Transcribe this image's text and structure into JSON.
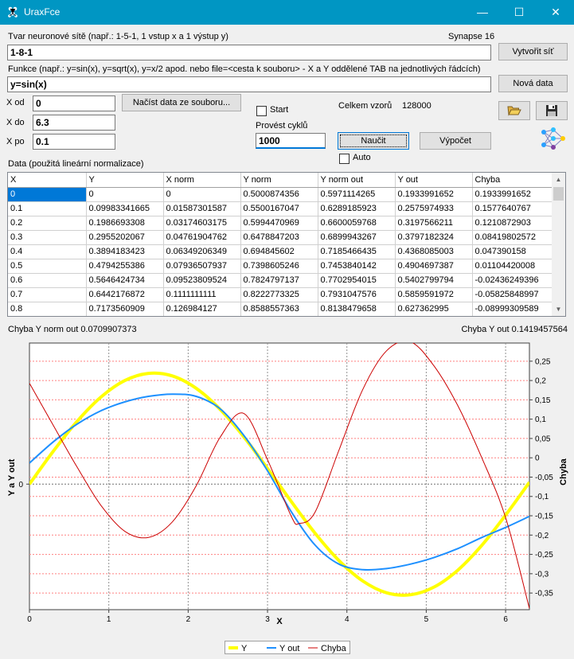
{
  "window": {
    "title": "UraxFce"
  },
  "network": {
    "label": "Tvar neuronové sítě (např.: 1-5-1, 1 vstup x a 1 výstup y)",
    "value": "1-8-1",
    "synapse": "Synapse 16",
    "create_button": "Vytvořit síť"
  },
  "function": {
    "label": "Funkce (např.: y=sin(x), y=sqrt(x), y=x/2 apod. nebo file=<cesta k souboru> - X a Y oddělené TAB na jednotlivých řádcích)",
    "value": "y=sin(x)",
    "new_data_button": "Nová data"
  },
  "range": {
    "x_from_label": "X od",
    "x_from": "0",
    "x_to_label": "X do",
    "x_to": "6.3",
    "x_step_label": "X po",
    "x_step": "0.1"
  },
  "controls": {
    "load_button": "Načíst data ze souboru...",
    "start_label": "Start",
    "cycles_label": "Provést cyklů",
    "cycles_value": "1000",
    "total_label": "Celkem vzorů",
    "total_value": "128000",
    "learn_button": "Naučit",
    "compute_button": "Výpočet",
    "auto_label": "Auto"
  },
  "data_label": "Data (použitá lineární normalizace)",
  "table": {
    "columns": [
      "X",
      "Y",
      "X norm",
      "Y norm",
      "Y norm out",
      "Y out",
      "Chyba"
    ],
    "rows": [
      [
        "0",
        "0",
        "0",
        "0.5000874356",
        "0.5971114265",
        "0.1933991652",
        "0.1933991652"
      ],
      [
        "0.1",
        "0.09983341665",
        "0.01587301587",
        "0.5500167047",
        "0.6289185923",
        "0.2575974933",
        "0.1577640767"
      ],
      [
        "0.2",
        "0.1986693308",
        "0.03174603175",
        "0.5994470969",
        "0.6600059768",
        "0.3197566211",
        "0.1210872903"
      ],
      [
        "0.3",
        "0.2955202067",
        "0.04761904762",
        "0.6478847203",
        "0.6899943267",
        "0.3797182324",
        "0.08419802572"
      ],
      [
        "0.4",
        "0.3894183423",
        "0.06349206349",
        "0.694845602",
        "0.7185466435",
        "0.4368085003",
        "0.047390158"
      ],
      [
        "0.5",
        "0.4794255386",
        "0.07936507937",
        "0.7398605246",
        "0.7453840142",
        "0.4904697387",
        "0.01104420008"
      ],
      [
        "0.6",
        "0.5646424734",
        "0.09523809524",
        "0.7824797137",
        "0.7702954015",
        "0.5402799794",
        "-0.02436249396"
      ],
      [
        "0.7",
        "0.6442176872",
        "0.1111111111",
        "0.8222773325",
        "0.7931047576",
        "0.5859591972",
        "-0.05825848997"
      ],
      [
        "0.8",
        "0.7173560909",
        "0.126984127",
        "0.8588557363",
        "0.8138479658",
        "0.627362995",
        "-0.08999309589"
      ]
    ]
  },
  "errors": {
    "norm_label": "Chyba Y norm out 0.0709907373",
    "out_label": "Chyba Y out 0.1419457564"
  },
  "colors": {
    "y": "#ffff00",
    "y_out": "#1e90ff",
    "chyba": "#cc0000",
    "titlebar": "#0096c3"
  },
  "chart_data": {
    "type": "line",
    "xlabel": "X",
    "ylabel": "Y a Y out",
    "y2label": "Chyba",
    "x_ticks": [
      "0",
      "1",
      "2",
      "3",
      "4",
      "5",
      "6"
    ],
    "y_ticks": [
      "0"
    ],
    "y2_ticks": [
      "0,25",
      "0,2",
      "0,15",
      "0,1",
      "0,05",
      "0",
      "-0,05",
      "-0,1",
      "-0,15",
      "-0,2",
      "-0,25",
      "-0,3",
      "-0,35"
    ],
    "xlim": [
      0,
      6.3
    ],
    "ylim": [
      -1.13,
      1.27
    ],
    "y2lim": [
      -0.393,
      0.297
    ],
    "legend_position": "bottom-center",
    "grid": true,
    "series": [
      {
        "name": "Y",
        "color": "#ffff00",
        "x": [
          0,
          0.3,
          0.6,
          0.9,
          1.2,
          1.5,
          1.8,
          2.1,
          2.4,
          2.7,
          3.0,
          3.3,
          3.6,
          3.9,
          4.2,
          4.5,
          4.8,
          5.1,
          5.4,
          5.7,
          6.0,
          6.3
        ],
        "values": [
          0,
          0.296,
          0.565,
          0.783,
          0.932,
          0.997,
          0.974,
          0.863,
          0.675,
          0.427,
          0.141,
          -0.158,
          -0.443,
          -0.688,
          -0.872,
          -0.978,
          -0.996,
          -0.926,
          -0.773,
          -0.551,
          -0.279,
          0.017
        ]
      },
      {
        "name": "Y out",
        "color": "#1e90ff",
        "x": [
          0,
          0.3,
          0.6,
          0.9,
          1.2,
          1.5,
          1.8,
          2.1,
          2.4,
          2.7,
          3.0,
          3.3,
          3.6,
          3.9,
          4.2,
          4.5,
          4.8,
          5.1,
          5.4,
          5.7,
          6.0,
          6.3
        ],
        "values": [
          0.19,
          0.38,
          0.54,
          0.66,
          0.74,
          0.79,
          0.81,
          0.79,
          0.68,
          0.44,
          0.12,
          -0.25,
          -0.55,
          -0.72,
          -0.77,
          -0.76,
          -0.72,
          -0.66,
          -0.58,
          -0.48,
          -0.39,
          -0.29
        ]
      },
      {
        "name": "Chyba",
        "color": "#cc0000",
        "axis": "y2",
        "x": [
          0,
          0.3,
          0.6,
          0.9,
          1.2,
          1.5,
          1.8,
          2.1,
          2.4,
          2.7,
          3.0,
          3.3,
          3.4,
          3.6,
          3.9,
          4.2,
          4.5,
          4.8,
          5.1,
          5.4,
          5.7,
          6.0,
          6.3
        ],
        "values": [
          0.193,
          0.084,
          -0.024,
          -0.123,
          -0.19,
          -0.206,
          -0.166,
          -0.073,
          0.052,
          0.115,
          -0.005,
          -0.152,
          -0.17,
          -0.14,
          0.02,
          0.177,
          0.277,
          0.3,
          0.237,
          0.134,
          0.0,
          -0.155,
          -0.39
        ]
      }
    ]
  }
}
